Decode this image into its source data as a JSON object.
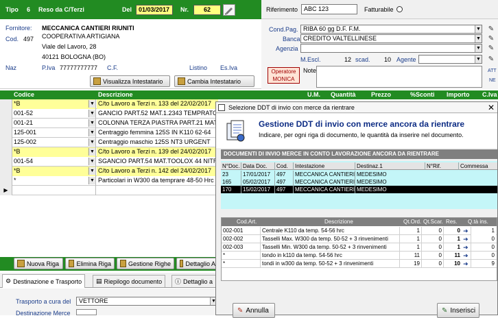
{
  "header": {
    "tipo_label": "Tipo",
    "tipo_value": "6",
    "reso_label": "Reso da C/Terzi",
    "del_label": "Del",
    "date_value": "01/03/2017",
    "nr_label": "Nr.",
    "nr_value": "62",
    "riferimento_label": "Riferimento",
    "riferimento_value": "ABC 123",
    "fatturabile_label": "Fatturabile"
  },
  "fornitore": {
    "label": "Fornitore:",
    "name": "MECCANICA CANTIERI RIUNITI",
    "cod_label": "Cod.",
    "cod_value": "497",
    "line2": "COOPERATIVA ARTIGIANA",
    "address": "Viale del Lavoro, 28",
    "city": "40121 BOLOGNA (BO)",
    "naz_label": "Naz",
    "piva_label": "P.Iva",
    "piva_value": "77777777777",
    "cf_label": "C.F.",
    "listino_label": "Listino",
    "esiva_label": "Es.Iva",
    "visualizza_button": "Visualizza Intestatario",
    "cambia_button": "Cambia Intestatario"
  },
  "conditions": {
    "condpag_label": "Cond.Pag.",
    "condpag_value": "RIBA 60 gg D.F. F.M.",
    "banca_label": "Banca",
    "banca_value": "CREDITO VALTELLINESE",
    "agenzia_label": "Agenzia",
    "mescl_label": "M.Escl.",
    "mescl_value": "12",
    "scad_label": "scad.",
    "scad_value": "10",
    "agente_label": "Agente",
    "operatore_label": "Operatore",
    "operatore_value": "MONICA",
    "note_label": "Note",
    "att_label": "ATT",
    "ne_label": "NE"
  },
  "grid": {
    "columns": [
      "Codice",
      "Descrizione",
      "U.M.",
      "Quantità",
      "Prezzo",
      "%Sconti",
      "Importo",
      "C.Iva"
    ],
    "rows": [
      {
        "code": "*B",
        "desc": "C/to Lavoro a Terzi n. 133 del 22/02/2017",
        "highlight": true,
        "indicator": ""
      },
      {
        "code": "001-52",
        "desc": "GANCIO PART.52  MAT.1.2343 TEMPRATO",
        "highlight": false,
        "indicator": ""
      },
      {
        "code": "001-21",
        "desc": "COLONNA TERZA PIASTRA PART.21  MAT",
        "highlight": false,
        "indicator": ""
      },
      {
        "code": "125-001",
        "desc": "Centraggio femmina 125S IN K110 62-64",
        "highlight": false,
        "indicator": ""
      },
      {
        "code": "125-002",
        "desc": "Centraggio  maschio 125S  NT3 URGENT",
        "highlight": false,
        "indicator": ""
      },
      {
        "code": "*B",
        "desc": "C/to Lavoro a Terzi n. 139 del 24/02/2017",
        "highlight": true,
        "indicator": ""
      },
      {
        "code": "001-54",
        "desc": "SGANCIO PART.54  MAT.TOOLOX 44 NITR",
        "highlight": false,
        "indicator": ""
      },
      {
        "code": "*B",
        "desc": "C/to Lavoro a Terzi n. 142 del 24/02/2017",
        "highlight": true,
        "indicator": ""
      },
      {
        "code": "*",
        "desc": "Particolari in W300 da temprare 48-50 Hrc",
        "highlight": false,
        "indicator": ""
      },
      {
        "code": "",
        "desc": "",
        "highlight": false,
        "indicator": "▶"
      }
    ]
  },
  "toolbar": {
    "nuova_riga": "Nuova Riga",
    "elimina_riga": "Elimina Riga",
    "gestione_righe": "Gestione Righe",
    "dettaglio": "Dettaglio A"
  },
  "tabs": {
    "destinazione": "Destinazione e Trasporto",
    "riepilogo": "Riepilogo documento",
    "dettaglio": "Dettaglio a"
  },
  "trasporto": {
    "label": "Trasporto a cura del",
    "value": "VETTORE",
    "destinazione_label": "Destinazione Merce"
  },
  "dialog": {
    "title": "Selezione DDT di invio con merce da rientrare",
    "heading": "Gestione DDT di invio con merce ancora da rientrare",
    "subheading": "Indicare, per ogni riga di documento, le quantità da inserire nel documento.",
    "section": "DOCUMENTI DI INVIO MERCE IN CONTO LAVORAZIONE ANCORA DA RIENTRARE",
    "docs_columns": [
      "N°Doc.",
      "Data Doc.",
      "Cod.",
      "Intestazione",
      "Destinaz.1",
      "N°Rif.",
      "Commessa"
    ],
    "docs_rows": [
      {
        "ndoc": "23",
        "data": "17/01/2017",
        "cod": "497",
        "intest": "MECCANICA CANTIERI",
        "dest": "MEDESIMO",
        "selected": false
      },
      {
        "ndoc": "165",
        "data": "05/02/2017",
        "cod": "497",
        "intest": "MECCANICA CANTIERI",
        "dest": "MEDESIMO",
        "selected": false
      },
      {
        "ndoc": "170",
        "data": "15/02/2017",
        "cod": "497",
        "intest": "MECCANICA CANTIERI",
        "dest": "MEDESIMO",
        "selected": true
      }
    ],
    "items_columns": [
      "Cod.Art.",
      "Descrizione",
      "Qt.Ord.",
      "Qt.Scar.",
      "Res.",
      "Q.tà ins."
    ],
    "items_rows": [
      {
        "code": "002-001",
        "desc": "Centrale K110 da temp. 54-56 hrc",
        "qtord": "1",
        "qtscar": "0",
        "res": "0",
        "qtains": "1"
      },
      {
        "code": "002-002",
        "desc": "Tasselli Max. W300 da temp. 50-52 + 3 rinvenimenti",
        "qtord": "1",
        "qtscar": "0",
        "res": "1",
        "qtains": "0"
      },
      {
        "code": "002-003",
        "desc": "Tasselli Min. W300 da temp. 50-52 + 3 rinvenimenti",
        "qtord": "1",
        "qtscar": "0",
        "res": "1",
        "qtains": "0"
      },
      {
        "code": "*",
        "desc": "tondo in k110 da temp. 54-56 hrc",
        "qtord": "11",
        "qtscar": "0",
        "res": "11",
        "qtains": "0"
      },
      {
        "code": "*",
        "desc": "tondi in w300 da temp. 50-52 + 3 rinvenimenti",
        "qtord": "19",
        "qtscar": "0",
        "res": "10",
        "qtains": "9"
      }
    ],
    "annulla": "Annulla",
    "inserisci": "Inserisci"
  }
}
